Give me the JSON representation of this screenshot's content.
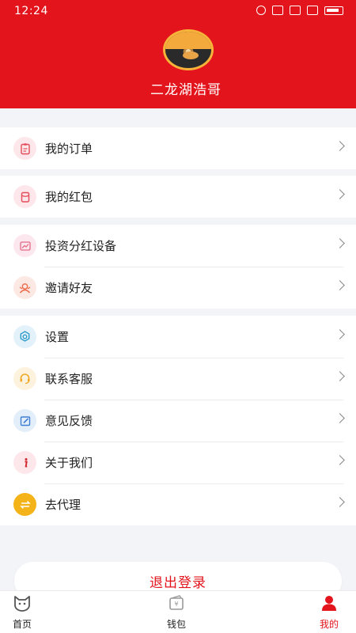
{
  "status": {
    "time": "12:24"
  },
  "profile": {
    "name": "二龙湖浩哥"
  },
  "groups": [
    {
      "items": [
        {
          "label": "我的订单",
          "icon": "order-icon",
          "color": "#e34b5a",
          "bg": "#fde7ea"
        }
      ]
    },
    {
      "items": [
        {
          "label": "我的红包",
          "icon": "red-packet-icon",
          "color": "#e34b5a",
          "bg": "#fde7ea"
        }
      ]
    },
    {
      "items": [
        {
          "label": "投资分红设备",
          "icon": "chart-icon",
          "color": "#e36a86",
          "bg": "#fde7ee"
        },
        {
          "label": "邀请好友",
          "icon": "invite-friends-icon",
          "color": "#ea6a4a",
          "bg": "#fde9e4"
        }
      ]
    },
    {
      "items": [
        {
          "label": "设置",
          "icon": "gear-icon",
          "color": "#2f9ac9",
          "bg": "#e3f2fa"
        },
        {
          "label": "联系客服",
          "icon": "headset-icon",
          "color": "#f1a625",
          "bg": "#fdf2de"
        },
        {
          "label": "意见反馈",
          "icon": "feedback-icon",
          "color": "#3f7fd3",
          "bg": "#e3eefb"
        },
        {
          "label": "关于我们",
          "icon": "info-icon",
          "color": "#d2262e",
          "bg": "#fde7ea"
        },
        {
          "label": "去代理",
          "icon": "swap-icon",
          "color": "#ffffff",
          "bg": "#f5b31a"
        }
      ]
    }
  ],
  "logout": {
    "label": "退出登录"
  },
  "tabbar": [
    {
      "label": "首页",
      "icon": "home-cat-icon"
    },
    {
      "label": "钱包",
      "icon": "wallet-icon"
    },
    {
      "label": "我的",
      "icon": "user-icon"
    }
  ],
  "colors": {
    "primary": "#e3141b",
    "background": "#f3f4f8"
  }
}
